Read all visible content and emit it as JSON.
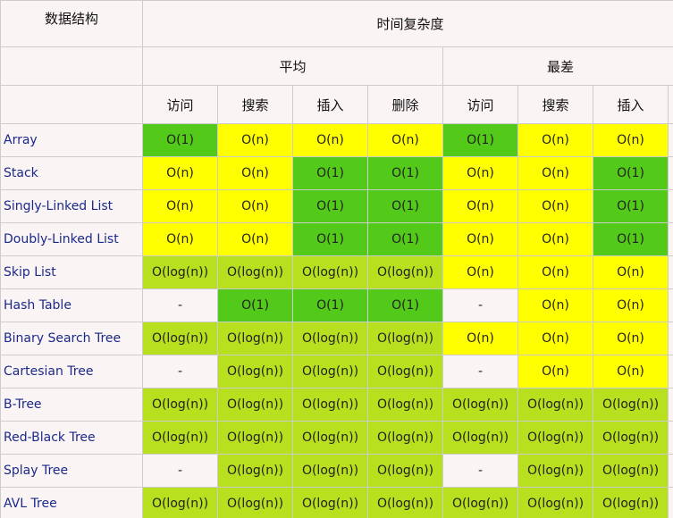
{
  "header": {
    "data_structure": "数据结构",
    "time_complexity": "时间复杂度",
    "average": "平均",
    "worst": "最差",
    "ops_average": [
      "访问",
      "搜索",
      "插入",
      "删除"
    ],
    "ops_worst": [
      "访问",
      "搜索",
      "插入"
    ]
  },
  "colors": {
    "green": "#53c91a",
    "lime": "#b9e01e",
    "yellow": "#ffff00",
    "none": "#fbf4f4",
    "link": "#1a2a8a"
  },
  "rows": [
    {
      "name": "Array",
      "values": [
        "O(1)",
        "O(n)",
        "O(n)",
        "O(n)",
        "O(1)",
        "O(n)",
        "O(n)"
      ],
      "colors": [
        "green",
        "yellow",
        "yellow",
        "yellow",
        "green",
        "yellow",
        "yellow"
      ]
    },
    {
      "name": "Stack",
      "values": [
        "O(n)",
        "O(n)",
        "O(1)",
        "O(1)",
        "O(n)",
        "O(n)",
        "O(1)"
      ],
      "colors": [
        "yellow",
        "yellow",
        "green",
        "green",
        "yellow",
        "yellow",
        "green"
      ]
    },
    {
      "name": "Singly-Linked List",
      "values": [
        "O(n)",
        "O(n)",
        "O(1)",
        "O(1)",
        "O(n)",
        "O(n)",
        "O(1)"
      ],
      "colors": [
        "yellow",
        "yellow",
        "green",
        "green",
        "yellow",
        "yellow",
        "green"
      ]
    },
    {
      "name": "Doubly-Linked List",
      "values": [
        "O(n)",
        "O(n)",
        "O(1)",
        "O(1)",
        "O(n)",
        "O(n)",
        "O(1)"
      ],
      "colors": [
        "yellow",
        "yellow",
        "green",
        "green",
        "yellow",
        "yellow",
        "green"
      ]
    },
    {
      "name": "Skip List",
      "values": [
        "O(log(n))",
        "O(log(n))",
        "O(log(n))",
        "O(log(n))",
        "O(n)",
        "O(n)",
        "O(n)"
      ],
      "colors": [
        "lime",
        "lime",
        "lime",
        "lime",
        "yellow",
        "yellow",
        "yellow"
      ]
    },
    {
      "name": "Hash Table",
      "values": [
        "-",
        "O(1)",
        "O(1)",
        "O(1)",
        "-",
        "O(n)",
        "O(n)"
      ],
      "colors": [
        "none",
        "green",
        "green",
        "green",
        "none",
        "yellow",
        "yellow"
      ]
    },
    {
      "name": "Binary Search Tree",
      "values": [
        "O(log(n))",
        "O(log(n))",
        "O(log(n))",
        "O(log(n))",
        "O(n)",
        "O(n)",
        "O(n)"
      ],
      "colors": [
        "lime",
        "lime",
        "lime",
        "lime",
        "yellow",
        "yellow",
        "yellow"
      ]
    },
    {
      "name": "Cartesian Tree",
      "values": [
        "-",
        "O(log(n))",
        "O(log(n))",
        "O(log(n))",
        "-",
        "O(n)",
        "O(n)"
      ],
      "colors": [
        "none",
        "lime",
        "lime",
        "lime",
        "none",
        "yellow",
        "yellow"
      ]
    },
    {
      "name": "B-Tree",
      "values": [
        "O(log(n))",
        "O(log(n))",
        "O(log(n))",
        "O(log(n))",
        "O(log(n))",
        "O(log(n))",
        "O(log(n))"
      ],
      "colors": [
        "lime",
        "lime",
        "lime",
        "lime",
        "lime",
        "lime",
        "lime"
      ]
    },
    {
      "name": "Red-Black Tree",
      "values": [
        "O(log(n))",
        "O(log(n))",
        "O(log(n))",
        "O(log(n))",
        "O(log(n))",
        "O(log(n))",
        "O(log(n))"
      ],
      "colors": [
        "lime",
        "lime",
        "lime",
        "lime",
        "lime",
        "lime",
        "lime"
      ]
    },
    {
      "name": "Splay Tree",
      "values": [
        "-",
        "O(log(n))",
        "O(log(n))",
        "O(log(n))",
        "-",
        "O(log(n))",
        "O(log(n))"
      ],
      "colors": [
        "none",
        "lime",
        "lime",
        "lime",
        "none",
        "lime",
        "lime"
      ]
    },
    {
      "name": "AVL Tree",
      "values": [
        "O(log(n))",
        "O(log(n))",
        "O(log(n))",
        "O(log(n))",
        "O(log(n))",
        "O(log(n))",
        "O(log(n))"
      ],
      "colors": [
        "lime",
        "lime",
        "lime",
        "lime",
        "lime",
        "lime",
        "lime"
      ]
    }
  ]
}
